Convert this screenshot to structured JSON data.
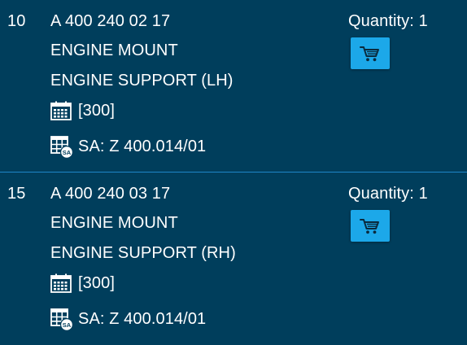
{
  "parts": [
    {
      "position": "10",
      "part_number": "A 400 240 02 17",
      "description1": "ENGINE MOUNT",
      "description2": "ENGINE SUPPORT (LH)",
      "quantity_label": "Quantity: 1",
      "period": "[300]",
      "sa_label": "SA: Z 400.014/01"
    },
    {
      "position": "15",
      "part_number": "A 400 240 03 17",
      "description1": "ENGINE MOUNT",
      "description2": "ENGINE SUPPORT (RH)",
      "quantity_label": "Quantity: 1",
      "period": "[300]",
      "sa_label": "SA: Z 400.014/01"
    }
  ],
  "icons": {
    "cart": "cart-icon",
    "calendar": "calendar-icon",
    "sa_table": "sa-table-icon"
  },
  "colors": {
    "background": "#003e5c",
    "divider": "#1f86c8",
    "button": "#1ca8e9",
    "text": "#ffffff"
  }
}
